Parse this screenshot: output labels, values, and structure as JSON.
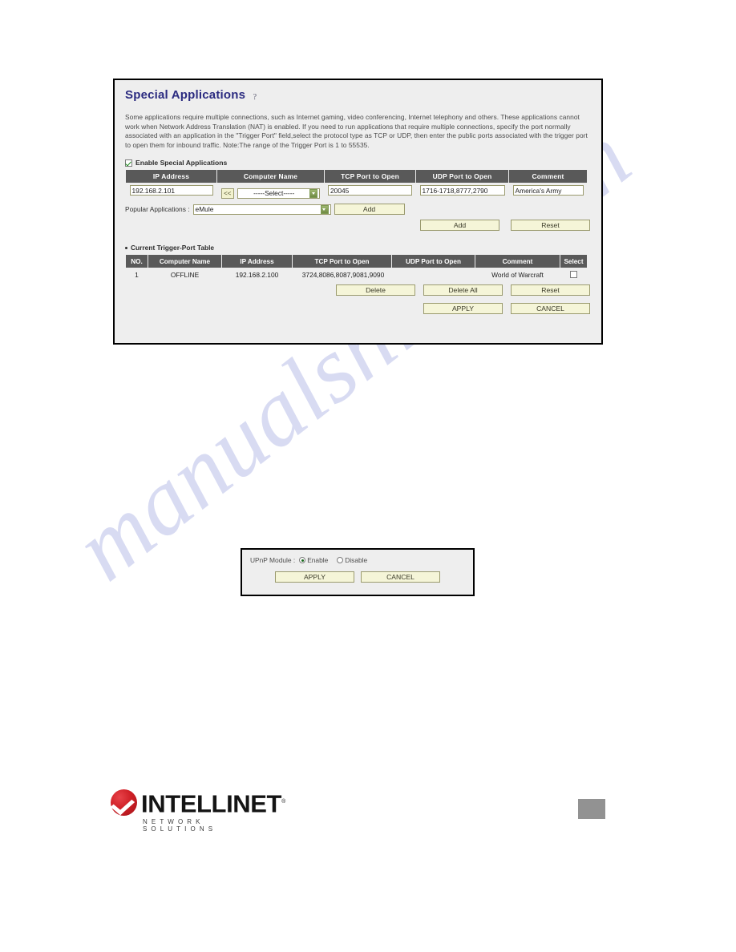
{
  "page": {
    "watermark": "manualshive.com",
    "page_number": ""
  },
  "panel": {
    "title": "Special Applications",
    "help_icon": "?",
    "description": "Some applications require multiple connections, such as Internet gaming, video conferencing, Internet telephony and others. These applications cannot work when Network Address Translation (NAT) is enabled. If you need to run applications that require multiple connections, specify the port normally associated with an application in the \"Trigger Port\" field,select the protocol type as TCP or UDP, then enter the public ports associated with the trigger port to open them for inbound traffic. Note:The range of the Trigger Port is 1 to 55535.",
    "enable_label": "Enable Special Applications",
    "enable_checked": true
  },
  "config_table": {
    "headers": [
      "IP Address",
      "Computer Name",
      "TCP Port to Open",
      "UDP Port to Open",
      "Comment"
    ],
    "row": {
      "ip_address": "192.168.2.101",
      "copy_button": "<<",
      "computer_name_selected": "-----Select-----",
      "tcp_port": "20045",
      "udp_port": "1716-1718,8777,2790",
      "comment": "America's Army"
    }
  },
  "popular": {
    "label": "Popular Applications :",
    "selected": "eMule",
    "add_label": "Add"
  },
  "form_buttons": {
    "add": "Add",
    "reset": "Reset"
  },
  "trigger_section": {
    "title": "Current Trigger-Port Table",
    "headers": [
      "NO.",
      "Computer Name",
      "IP Address",
      "TCP Port to Open",
      "UDP Port to Open",
      "Comment",
      "Select"
    ],
    "rows": [
      {
        "no": "1",
        "computer_name": "OFFLINE",
        "ip_address": "192.168.2.100",
        "tcp_port": "3724,8086,8087,9081,9090",
        "udp_port": "",
        "comment": "World of Warcraft",
        "selected": false
      }
    ],
    "buttons": {
      "delete": "Delete",
      "delete_all": "Delete All",
      "reset": "Reset"
    },
    "footer_buttons": {
      "apply": "APPLY",
      "cancel": "CANCEL"
    }
  },
  "upnp": {
    "label": "UPnP Module :",
    "enable_label": "Enable",
    "disable_label": "Disable",
    "selected": "Enable",
    "apply": "APPLY",
    "cancel": "CANCEL"
  },
  "footer": {
    "brand": "INTELLINET",
    "trademark": "®",
    "tagline": "NETWORK SOLUTIONS"
  },
  "colors": {
    "title": "#2b2b80",
    "table_header_bg": "#595959",
    "button_bg": "#f5f5d8",
    "button_border": "#9a9a6e",
    "panel_bg": "#eeeeee",
    "logo_red": "#cf1f26",
    "watermark": "#b9bfe8"
  }
}
